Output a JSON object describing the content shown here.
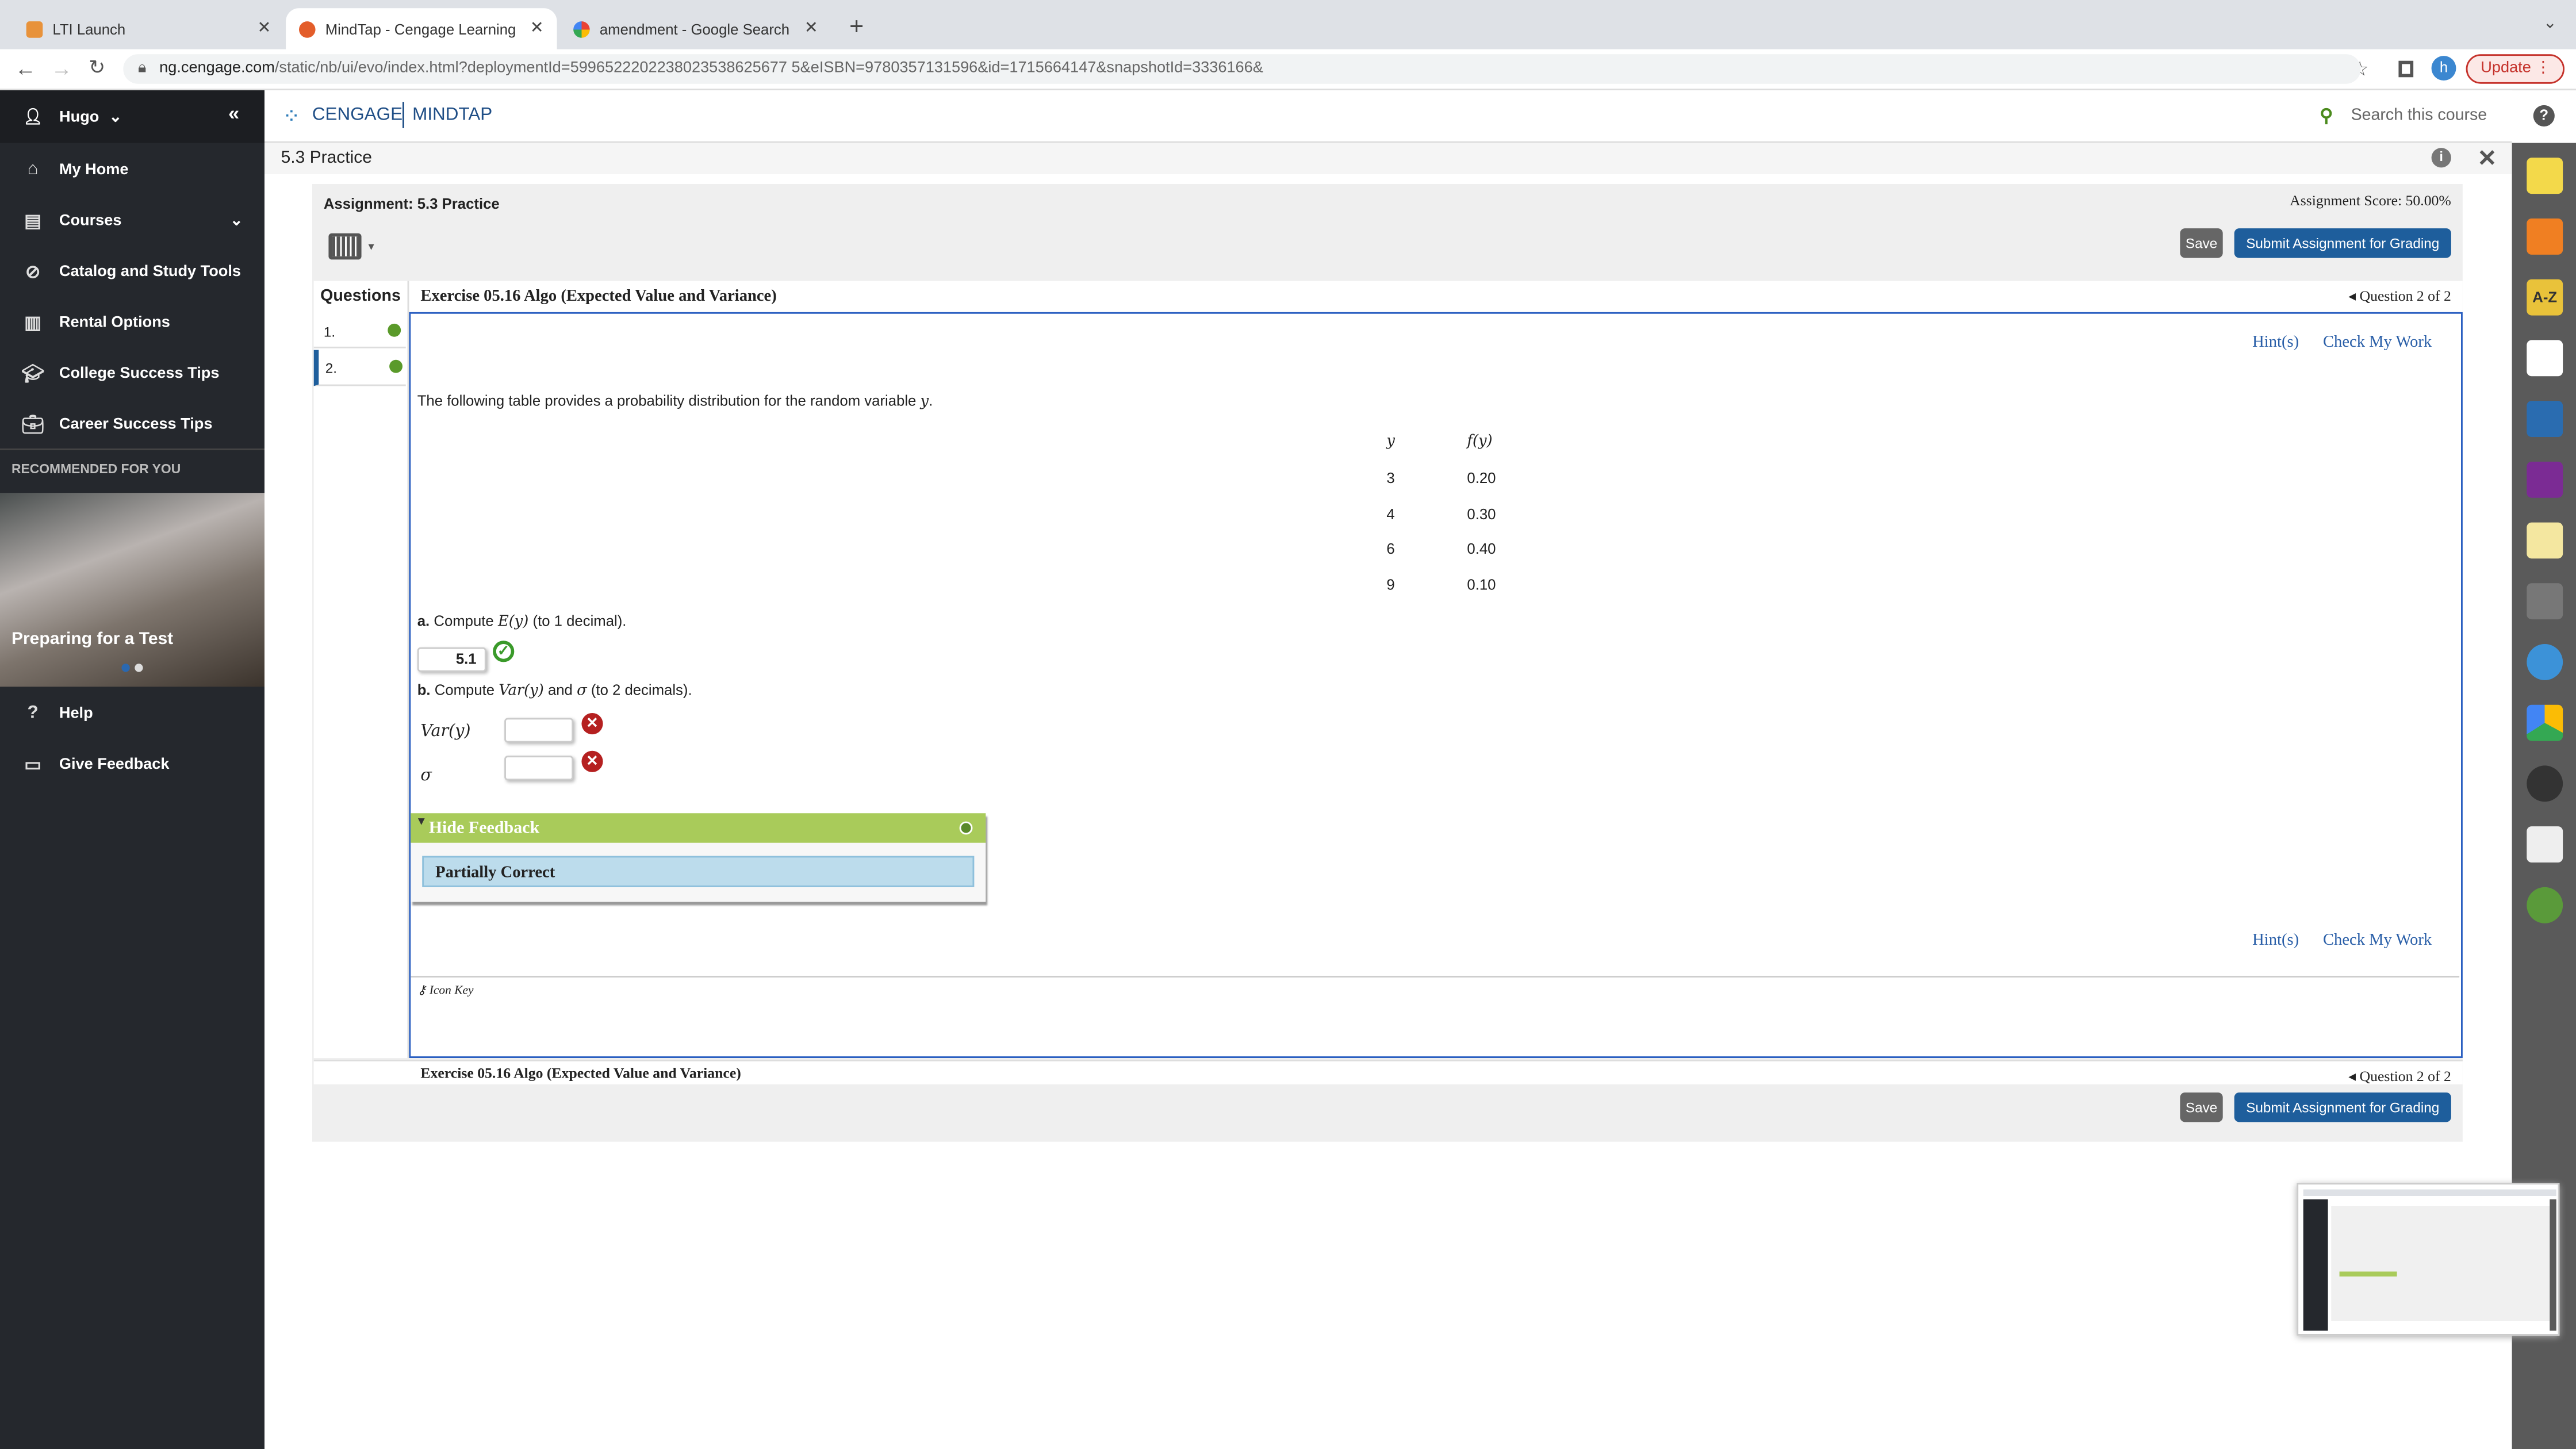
{
  "browser": {
    "tabs": [
      {
        "label": "LTI Launch"
      },
      {
        "label": "MindTap - Cengage Learning",
        "active": true
      },
      {
        "label": "amendment - Google Search"
      }
    ],
    "url_host": "ng.cengage.com",
    "url_path": "/static/nb/ui/evo/index.html?deploymentId=5996522202238023538625677 5&eISBN=9780357131596&id=1715664147&snapshotId=3336166&",
    "profile_initial": "h",
    "update_label": "Update"
  },
  "sidebar": {
    "user": "Hugo",
    "items": [
      {
        "label": "My Home",
        "icon": "home-icon"
      },
      {
        "label": "Courses",
        "icon": "book-icon"
      },
      {
        "label": "Catalog and Study Tools",
        "icon": "compass-icon"
      },
      {
        "label": "Rental Options",
        "icon": "open-book-icon"
      },
      {
        "label": "College Success Tips",
        "icon": "graduation-cap-icon"
      },
      {
        "label": "Career Success Tips",
        "icon": "briefcase-icon"
      }
    ],
    "recommended_heading": "RECOMMENDED FOR YOU",
    "promo_title": "Preparing for a Test",
    "promo_slides": 2,
    "promo_active_slide": 1,
    "bottom_items": [
      {
        "label": "Help",
        "icon": "help-icon"
      },
      {
        "label": "Give Feedback",
        "icon": "feedback-icon"
      }
    ]
  },
  "header": {
    "brand": "CENGAGE",
    "product": "MINDTAP",
    "search_label": "Search this course"
  },
  "page": {
    "title": "5.3 Practice"
  },
  "assignment": {
    "label": "Assignment: 5.3 Practice",
    "score": "Assignment Score: 50.00%",
    "save": "Save",
    "submit": "Submit Assignment for Grading",
    "questions_header": "Questions",
    "questions": [
      {
        "label": "1.",
        "status": "partial"
      },
      {
        "label": "2.",
        "status": "partial",
        "active": true
      }
    ],
    "exercise_title": "Exercise 05.16 Algo (Expected Value and Variance)",
    "question_position": "Question 2 of 2",
    "hints": "Hint(s)",
    "check": "Check My Work",
    "intro": "The following table provides a probability distribution for the random variable",
    "intro_var": "y",
    "intro_end": ".",
    "table": {
      "headers": [
        "y",
        "f(y)"
      ],
      "rows": [
        [
          "3",
          "0.20"
        ],
        [
          "4",
          "0.30"
        ],
        [
          "6",
          "0.40"
        ],
        [
          "9",
          "0.10"
        ]
      ]
    },
    "part_a": {
      "letter": "a.",
      "text_pre": "Compute",
      "math": "E(y)",
      "text_post": "(to 1 decimal).",
      "answer": "5.1",
      "status": "correct"
    },
    "part_b": {
      "letter": "b.",
      "text_pre": "Compute",
      "math": "Var(y)",
      "text_mid": "and",
      "math2": "σ",
      "text_post": "(to 2 decimals).",
      "fields": [
        {
          "label": "Var(y)",
          "value": "",
          "status": "incorrect"
        },
        {
          "label": "σ",
          "value": "",
          "status": "incorrect"
        }
      ]
    },
    "feedback": {
      "toggle": "Hide Feedback",
      "result": "Partially Correct"
    },
    "icon_key": "Icon Key"
  },
  "colors": {
    "accent": "#1e5e9c",
    "feedback_green": "#a9cb5a",
    "feedback_blue": "#bcdcec",
    "sidebar": "#25282d"
  }
}
